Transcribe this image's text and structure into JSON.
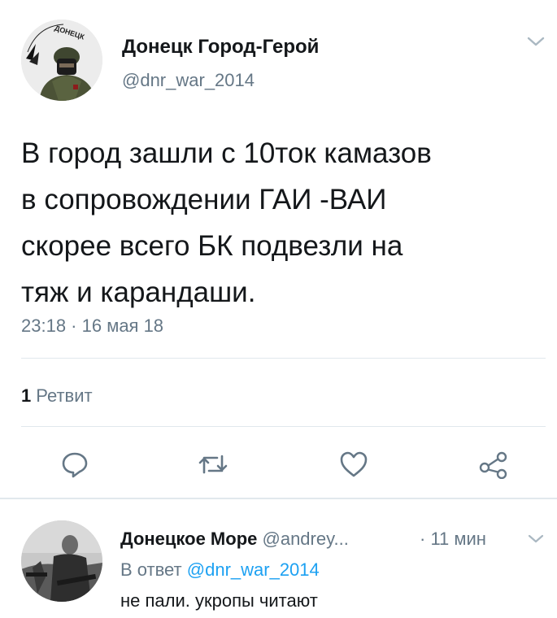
{
  "tweet": {
    "author_name": "Донецк Город-Герой",
    "author_handle": "@dnr_war_2014",
    "avatar_stamp_text": "ДОНЕЦК",
    "text_lines": [
      "В город зашли с 10ток камазов",
      "в сопровождении ГАИ -ВАИ",
      "скорее всего БК подвезли на",
      "тяж и карандаши."
    ],
    "timestamp": "23:18 · 16 мая 18",
    "retweet_count": "1",
    "retweet_label": "Ретвит"
  },
  "actions": [
    {
      "name": "reply",
      "icon": "reply-icon"
    },
    {
      "name": "retweet",
      "icon": "retweet-icon"
    },
    {
      "name": "like",
      "icon": "heart-icon"
    },
    {
      "name": "share",
      "icon": "share-icon"
    }
  ],
  "reply": {
    "author_name": "Донецкое Море",
    "author_handle": "@andrey...",
    "time": "· 11 мин",
    "in_reply_to_label": "В ответ",
    "in_reply_to_handle": "@dnr_war_2014",
    "text": "не пали. укропы читают"
  },
  "colors": {
    "text": "#14171a",
    "secondary": "#657786",
    "link": "#1da1f2",
    "divider": "#e1e8ed"
  }
}
